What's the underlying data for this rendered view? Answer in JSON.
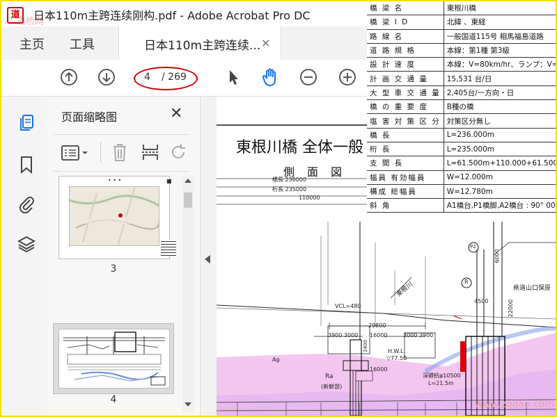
{
  "window": {
    "title": "日本110m主跨连续刚构.pdf - Adobe Acrobat Pro DC",
    "app_logo_glyph": "道",
    "watermark": "道桥网"
  },
  "menubar": {
    "home": "主页",
    "tools": "工具",
    "doc_tab_title": "日本110m主跨连续...",
    "doc_tab_close": "×"
  },
  "toolbar": {
    "page_current": "4",
    "page_total": "/ 269"
  },
  "thumb_panel": {
    "title": "页面缩略图",
    "close": "✕",
    "thumbnails": [
      {
        "label": "3"
      },
      {
        "label": "4"
      }
    ]
  },
  "document": {
    "drawing_title": "東根川橋 全体一般",
    "drawing_subtitle": "側面図",
    "dims": [
      "橋長 236000",
      "桁長 235000",
      "110000"
    ],
    "elev_labels": [
      "29800",
      "16000",
      "3900 3000",
      "3000 3900",
      "16000",
      "H.W.L",
      "▽77.50",
      "4500",
      "22000",
      "6000",
      "2400"
    ],
    "annotations": [
      "東根川",
      "VCL=480",
      "県道山口保原",
      "深礎杭φ10500",
      "L=21.5m",
      "Ra",
      "(新鮮部)",
      "R",
      "P2",
      "Ag"
    ],
    "bottom_watermark": "www.zqdao.com"
  },
  "spec_table": {
    "rows": [
      {
        "k": "橋 梁 名",
        "v": "東根川橋"
      },
      {
        "k": "橋 梁 I D",
        "v": "北緯 、東経"
      },
      {
        "k": "路 線 名",
        "v": "一般国道115号 相馬福島道路"
      },
      {
        "k": "道 路 規 格",
        "v": "本線：第1種 第3級"
      },
      {
        "k": "設 計 速 度",
        "v": "本線：V=80km/hr、ランプ：V=40"
      },
      {
        "k": "計 画 交 通 量",
        "v": "15,531 台/日"
      },
      {
        "k": "大 型 車 交 通 量",
        "v": "2,405台/一方向・日"
      },
      {
        "k": "橋 の 重 要 度",
        "v": "B種の橋"
      },
      {
        "k": "塩 害 対 策 区 分",
        "v": "対策区分無し"
      },
      {
        "k": "橋 長",
        "v": "L=236.000m"
      },
      {
        "k": "桁 長",
        "v": "L=235.000m"
      },
      {
        "k": "支 間 長",
        "v": "L=61.500m+110.000+61.500m"
      },
      {
        "k": "幅員 有効幅員",
        "v": "W=12.000m"
      },
      {
        "k": "構成 総幅員",
        "v": "W=12.780m"
      },
      {
        "k": "斜 角",
        "v": "A1橋台,P1橋脚,A2橋台 : 90° 00"
      }
    ]
  },
  "colors": {
    "accent_red": "#d00000",
    "frame_yellow": "#f0e000",
    "hand_tool_blue": "#1a73e8",
    "ground_pink": "#f3c6f0",
    "ground_blue": "#b8c8f0"
  }
}
